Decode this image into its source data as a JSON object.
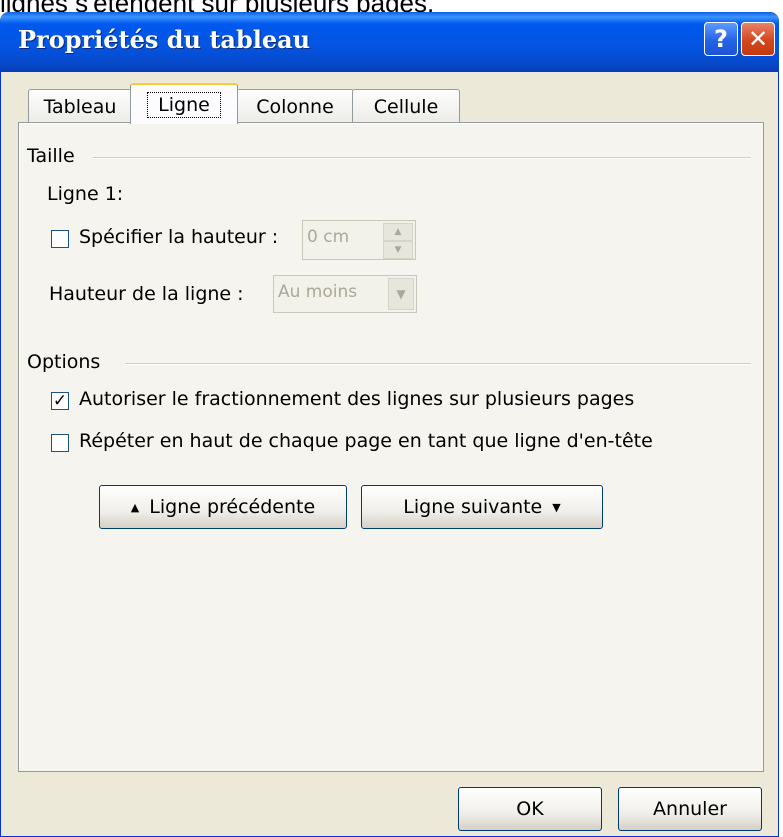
{
  "background_caption": "lignes s'étendent sur plusieurs pages.",
  "window": {
    "title": "Propriétés du tableau",
    "help_button": "?",
    "close_button": "✕"
  },
  "tabs": [
    {
      "label": "Tableau",
      "active": false
    },
    {
      "label": "Ligne",
      "active": true
    },
    {
      "label": "Colonne",
      "active": false
    },
    {
      "label": "Cellule",
      "active": false
    }
  ],
  "size_group": {
    "title": "Taille",
    "row_label": "Ligne 1:",
    "specify_height": {
      "label": "Spécifier la hauteur :",
      "checked": false
    },
    "height_value": "0 cm",
    "row_height_label": "Hauteur de la ligne :",
    "row_height_mode": "Au moins"
  },
  "options_group": {
    "title": "Options",
    "allow_break": {
      "label": "Autoriser le fractionnement des lignes sur plusieurs pages",
      "checked": true
    },
    "repeat_header": {
      "label": "Répéter en haut de chaque page en tant que ligne d'en-tête",
      "checked": false
    }
  },
  "nav": {
    "prev_label": "Ligne précédente",
    "prev_icon": "▲",
    "next_label": "Ligne suivante",
    "next_icon": "▼"
  },
  "footer": {
    "ok_label": "OK",
    "cancel_label": "Annuler"
  },
  "colors": {
    "titlebar": "#0058ee",
    "dialog_bg": "#ece9d8",
    "active_tab_accent": "#ffc73c"
  }
}
